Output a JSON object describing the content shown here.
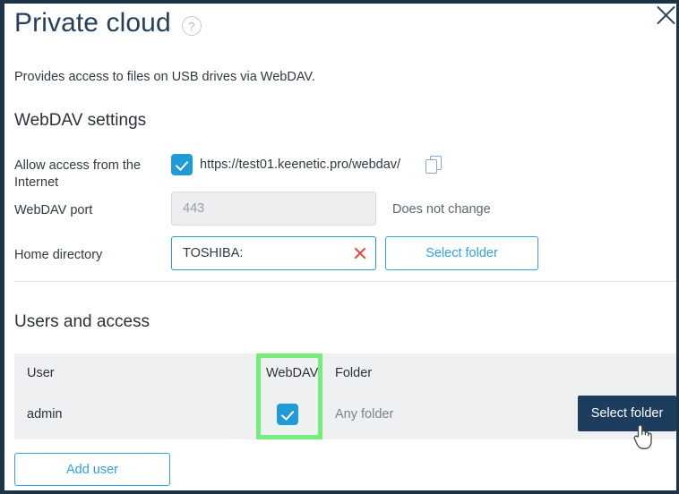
{
  "dialog": {
    "title": "Private cloud",
    "help_icon": "question-mark-circle-icon",
    "close_icon": "close-icon",
    "description": "Provides access to files on USB drives via WebDAV."
  },
  "webdav_settings": {
    "heading": "WebDAV settings",
    "allow_access": {
      "label": "Allow access from the Internet",
      "checked": true,
      "url": "https://test01.keenetic.pro/webdav/",
      "copy_icon": "copy-icon"
    },
    "port": {
      "label": "WebDAV port",
      "value": "",
      "placeholder": "443",
      "note": "Does not change"
    },
    "home_directory": {
      "label": "Home directory",
      "value": "TOSHIBA:",
      "clear_icon": "clear-x-icon",
      "select_folder_label": "Select folder"
    }
  },
  "users_and_access": {
    "heading": "Users and access",
    "columns": [
      "User",
      "WebDAV",
      "Folder"
    ],
    "rows": [
      {
        "user": "admin",
        "webdav": true,
        "folder": "Any folder",
        "action_label": "Select folder"
      }
    ],
    "add_user_label": "Add user"
  },
  "colors": {
    "title": "#24405c",
    "accent_blue": "#2ea4e0",
    "checkbox_blue": "#1f9bd7",
    "primary_button": "#1d3d5e",
    "highlight_green": "#76ed7a",
    "table_bg": "#eef0f2",
    "border_navy": "#1d3448",
    "clear_red": "#e8453c"
  }
}
